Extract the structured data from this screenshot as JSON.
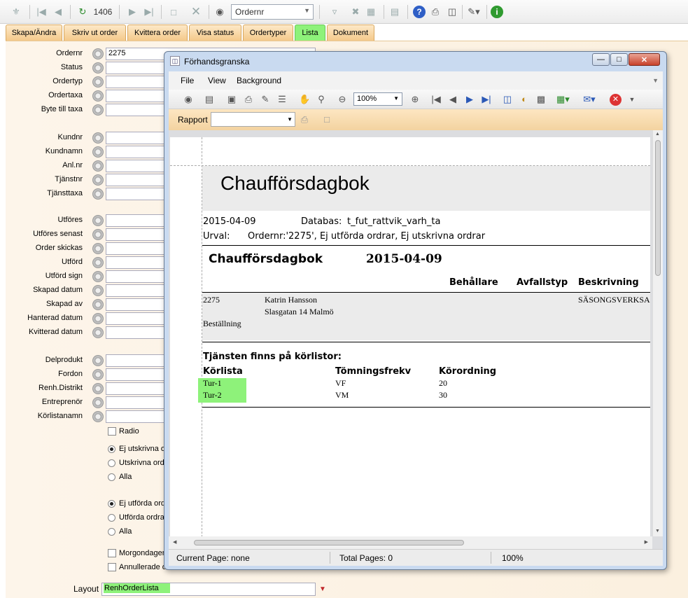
{
  "toolbar": {
    "record_number": "1406",
    "search_field": "Ordernr"
  },
  "tabs": [
    {
      "label": "Skapa/Ändra",
      "active": false
    },
    {
      "label": "Skriv ut order",
      "active": false
    },
    {
      "label": "Kvittera order",
      "active": false
    },
    {
      "label": "Visa status",
      "active": false
    },
    {
      "label": "Ordertyper",
      "active": false
    },
    {
      "label": "Lista",
      "active": true
    },
    {
      "label": "Dokument",
      "active": false
    }
  ],
  "form": {
    "fields": [
      {
        "label": "Ordernr",
        "value": "2275"
      },
      {
        "label": "Status",
        "value": ""
      },
      {
        "label": "Ordertyp",
        "value": ""
      },
      {
        "label": "Ordertaxa",
        "value": ""
      },
      {
        "label": "Byte till taxa",
        "value": ""
      },
      {
        "label": "Kundnr",
        "value": ""
      },
      {
        "label": "Kundnamn",
        "value": ""
      },
      {
        "label": "Anl.nr",
        "value": ""
      },
      {
        "label": "Tjänstnr",
        "value": ""
      },
      {
        "label": "Tjänsttaxa",
        "value": ""
      },
      {
        "label": "Utföres",
        "value": ""
      },
      {
        "label": "Utföres senast",
        "value": ""
      },
      {
        "label": "Order skickas",
        "value": ""
      },
      {
        "label": "Utförd",
        "value": ""
      },
      {
        "label": "Utförd sign",
        "value": ""
      },
      {
        "label": "Skapad datum",
        "value": ""
      },
      {
        "label": "Skapad av",
        "value": ""
      },
      {
        "label": "Hanterad datum",
        "value": ""
      },
      {
        "label": "Kvitterad datum",
        "value": ""
      },
      {
        "label": "Delprodukt",
        "value": ""
      },
      {
        "label": "Fordon",
        "value": ""
      },
      {
        "label": "Renh.Distrikt",
        "value": ""
      },
      {
        "label": "Entreprenör",
        "value": ""
      },
      {
        "label": "Körlistanamn",
        "value": ""
      }
    ],
    "radio_check": {
      "label": "Radio",
      "checked": false
    },
    "print_group": [
      {
        "label": "Ej utskrivna or",
        "selected": true
      },
      {
        "label": "Utskrivna ordr",
        "selected": false
      },
      {
        "label": "Alla",
        "selected": false
      }
    ],
    "done_group": [
      {
        "label": "Ej utförda ordr",
        "selected": true
      },
      {
        "label": "Utförda ordrar",
        "selected": false
      },
      {
        "label": "Alla",
        "selected": false
      }
    ],
    "check_morgon": {
      "label": "Morgondagens",
      "checked": false
    },
    "check_annul": {
      "label": "Annullerade or",
      "checked": false
    },
    "layout_label": "Layout",
    "layout_value": "RenhOrderLista"
  },
  "preview": {
    "title": "Förhandsgranska",
    "menu": [
      "File",
      "View",
      "Background"
    ],
    "zoom": "100%",
    "rapport_label": "Rapport",
    "report": {
      "heading": "Chaufförsdagbok",
      "date": "2015-04-09",
      "db_label": "Databas:",
      "db_value": "t_fut_rattvik_varh_ta",
      "urval_label": "Urval:",
      "urval_value": "Ordernr:'2275', Ej utförda ordrar, Ej utskrivna ordrar",
      "section_title": "Chaufförsdagbok",
      "section_date": "2015-04-09",
      "col_headers": [
        "Behållare",
        "Avfallstyp",
        "Beskrivning"
      ],
      "order_no": "2275",
      "customer_name": "Katrin Hansson",
      "customer_address": "Slasgatan 14 Malmö",
      "description": "SÄSONGSVERKSA",
      "order_label": "Beställning",
      "routes_title": "Tjänsten finns på körlistor:",
      "route_headers": [
        "Körlista",
        "Tömningsfrekv",
        "Körordning"
      ],
      "routes": [
        {
          "name": "Tur-1",
          "freq": "VF",
          "order": "20"
        },
        {
          "name": "Tur-2",
          "freq": "VM",
          "order": "30"
        }
      ]
    },
    "status": {
      "current_page": "Current Page: none",
      "total_pages": "Total Pages: 0",
      "zoom": "100%"
    }
  }
}
